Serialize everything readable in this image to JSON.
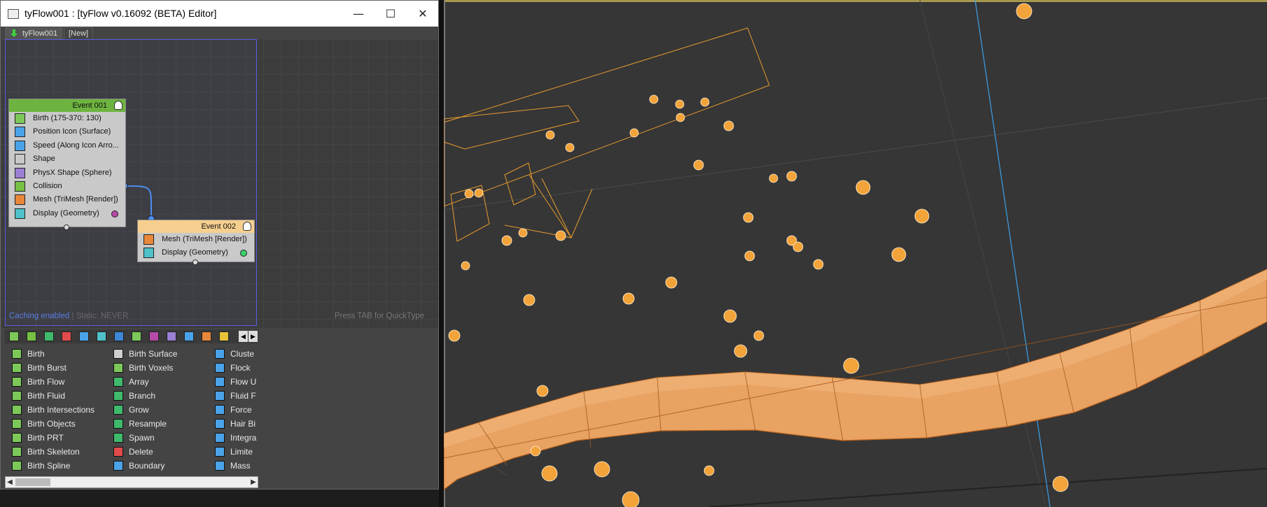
{
  "window": {
    "title": "tyFlow001 : [tyFlow v0.16092 (BETA) Editor]",
    "minimize_glyph": "—",
    "maximize_glyph": "☐",
    "close_glyph": "✕"
  },
  "tabs": [
    {
      "label": "tyFlow001",
      "icon": "green-arrow-down-icon"
    },
    {
      "label": "[New]"
    }
  ],
  "events": [
    {
      "title": "Event  001",
      "header_color": "#6db33f",
      "operators": [
        {
          "label": "Birth (175-370: 130)",
          "icon": "birth-icon",
          "color": "#7cc95a"
        },
        {
          "label": "Position Icon (Surface)",
          "icon": "position-icon-icon",
          "color": "#4aa3e8"
        },
        {
          "label": "Speed (Along Icon Arro...",
          "icon": "speed-icon",
          "color": "#4aa3e8"
        },
        {
          "label": "Shape",
          "icon": "shape-icon",
          "color": "#c8c8c8"
        },
        {
          "label": "PhysX Shape (Sphere)",
          "icon": "physx-shape-icon",
          "color": "#9b7fd4"
        },
        {
          "label": "Collision",
          "icon": "collision-icon",
          "color": "#76c043"
        },
        {
          "label": "Mesh (TriMesh [Render])",
          "icon": "mesh-icon",
          "color": "#e8873a"
        },
        {
          "label": "Display (Geometry)",
          "icon": "display-icon",
          "color": "#4fc1c9",
          "dot": "#b64aa9"
        }
      ]
    },
    {
      "title": "Event  002",
      "header_color": "#f6cf8f",
      "operators": [
        {
          "label": "Mesh (TriMesh [Render])",
          "icon": "mesh-icon",
          "color": "#e8873a"
        },
        {
          "label": "Display (Geometry)",
          "icon": "display-icon",
          "color": "#4fc1c9",
          "dot": "#38d36a"
        }
      ]
    }
  ],
  "status": {
    "caching": "Caching enabled",
    "separator": " | ",
    "static": "Static: NEVER",
    "hint": "Press TAB for QuickType"
  },
  "category_icons": [
    "#7cc95a",
    "#76c043",
    "#3fb96b",
    "#e24b4b",
    "#4aa3e8",
    "#4fc1c9",
    "#3d86d8",
    "#7cc95a",
    "#b64aa9",
    "#9b7fd4",
    "#4aa3e8",
    "#e8873a",
    "#e8c33a"
  ],
  "operator_columns": [
    [
      {
        "label": "Birth",
        "color": "#7cc95a"
      },
      {
        "label": "Birth Burst",
        "color": "#7cc95a"
      },
      {
        "label": "Birth Flow",
        "color": "#7cc95a"
      },
      {
        "label": "Birth Fluid",
        "color": "#7cc95a"
      },
      {
        "label": "Birth Intersections",
        "color": "#7cc95a"
      },
      {
        "label": "Birth Objects",
        "color": "#7cc95a"
      },
      {
        "label": "Birth PRT",
        "color": "#7cc95a"
      },
      {
        "label": "Birth Skeleton",
        "color": "#7cc95a"
      },
      {
        "label": "Birth Spline",
        "color": "#7cc95a"
      }
    ],
    [
      {
        "label": "Birth Surface",
        "color": "#d0d0d0"
      },
      {
        "label": "Birth Voxels",
        "color": "#7cc95a"
      },
      {
        "label": "Array",
        "color": "#3fb96b"
      },
      {
        "label": "Branch",
        "color": "#3fb96b"
      },
      {
        "label": "Grow",
        "color": "#3fb96b"
      },
      {
        "label": "Resample",
        "color": "#3fb96b"
      },
      {
        "label": "Spawn",
        "color": "#3fb96b"
      },
      {
        "label": "Delete",
        "color": "#e24b4b"
      },
      {
        "label": "Boundary",
        "color": "#4aa3e8"
      }
    ],
    [
      {
        "label": "Cluste",
        "color": "#4aa3e8"
      },
      {
        "label": "Flock",
        "color": "#4aa3e8"
      },
      {
        "label": "Flow U",
        "color": "#4aa3e8"
      },
      {
        "label": "Fluid F",
        "color": "#4aa3e8"
      },
      {
        "label": "Force",
        "color": "#4aa3e8"
      },
      {
        "label": "Hair Bi",
        "color": "#4aa3e8"
      },
      {
        "label": "Integra",
        "color": "#4aa3e8"
      },
      {
        "label": "Limite",
        "color": "#4aa3e8"
      },
      {
        "label": "Mass",
        "color": "#4aa3e8"
      }
    ]
  ],
  "viewport": {
    "background": "#363636",
    "particle_color": "#f2a33a",
    "mesh_color": "#e9a463"
  }
}
